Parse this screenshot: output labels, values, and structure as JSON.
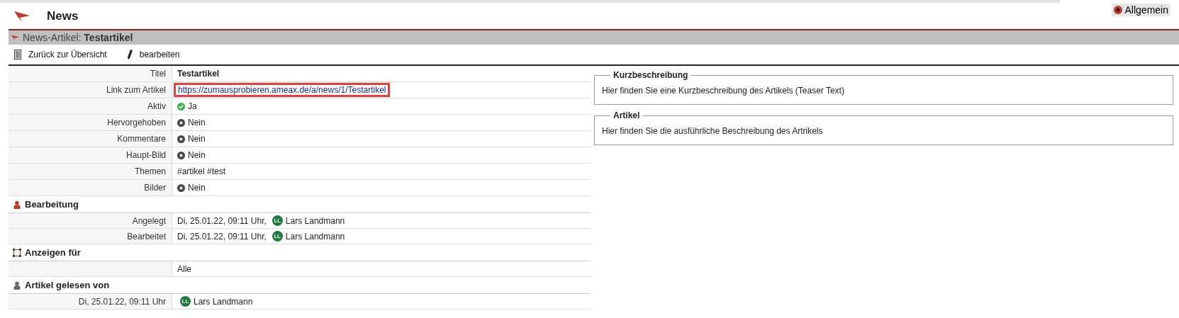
{
  "header": {
    "title": "News",
    "context_button": "Allgemein"
  },
  "panel": {
    "prefix": "News-Artikel: ",
    "title": "Testartikel"
  },
  "toolbar": [
    "Zurück zur Übersicht",
    "bearbeiten"
  ],
  "fields": [
    {
      "label": "Titel",
      "kind": "bold",
      "value": "Testartikel"
    },
    {
      "label": "Link zum Artikel",
      "kind": "link",
      "value": "https://zumausprobieren.ameax.de/a/news/1/Testartikel",
      "highlighted": true
    },
    {
      "label": "Aktiv",
      "kind": "bool",
      "on": true,
      "value": "Ja"
    },
    {
      "label": "Hervorgehoben",
      "kind": "bool",
      "on": false,
      "value": "Nein"
    },
    {
      "label": "Kommentare",
      "kind": "bool",
      "on": false,
      "value": "Nein"
    },
    {
      "label": "Haupt-Bild",
      "kind": "bool",
      "on": false,
      "value": "Nein"
    },
    {
      "label": "Themen",
      "kind": "text",
      "value": "#artikel #test"
    },
    {
      "label": "Bilder",
      "kind": "bool",
      "on": false,
      "value": "Nein"
    }
  ],
  "sections": [
    {
      "title": "Bearbeitung",
      "rows": [
        {
          "label": "Angelegt",
          "value": "Di, 25.01.22, 09:11 Uhr,",
          "user": {
            "initials": "LL",
            "name": "Lars Landmann"
          }
        },
        {
          "label": "Bearbeitet",
          "value": "Di, 25.01.22, 09:11 Uhr,",
          "user": {
            "initials": "LL",
            "name": "Lars Landmann"
          }
        }
      ]
    },
    {
      "title": "Anzeigen für",
      "rows": [
        {
          "value": "Alle"
        }
      ]
    },
    {
      "title": "Artikel gelesen von",
      "rows": [
        {
          "label": "Di, 25.01.22, 09:11 Uhr",
          "user": {
            "initials": "LL",
            "name": "Lars Landmann"
          }
        }
      ]
    }
  ],
  "boxes": [
    {
      "legend": "Kurzbeschreibung",
      "text": "Hier finden Sie eine Kurzbeschreibung des Artikels (Teaser Text)"
    },
    {
      "legend": "Artikel",
      "text": "Hier finden Sie die ausführliche Beschreibung des Artrikels"
    }
  ]
}
